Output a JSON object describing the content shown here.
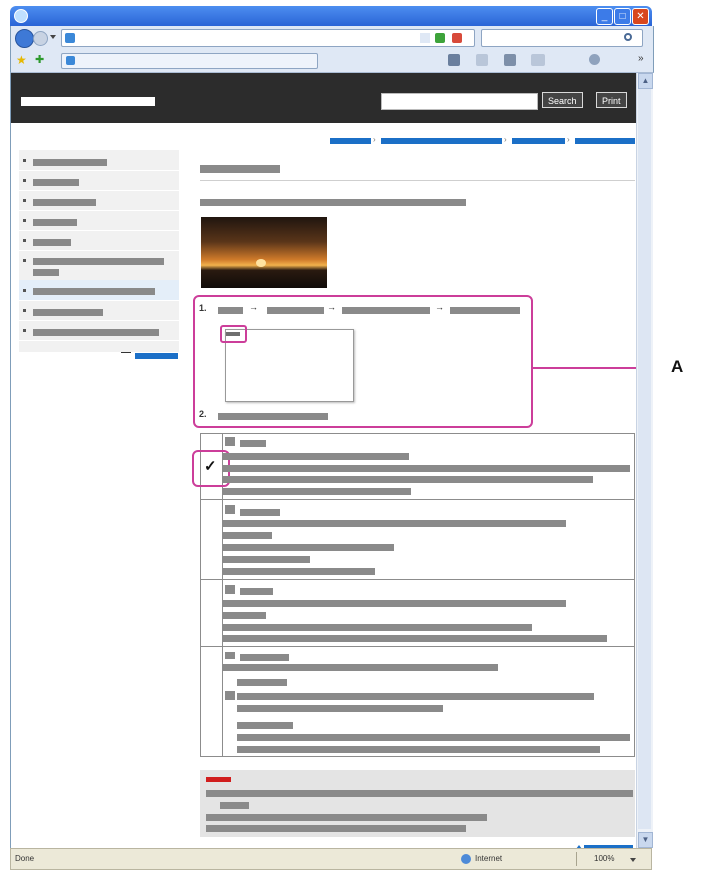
{
  "browser": {
    "window_controls": {
      "minimize": "_",
      "maximize": "□",
      "close": "✕"
    },
    "zoom": "100%",
    "status_left": "Done",
    "status_zone": "Internet"
  },
  "page": {
    "search_button": "Search",
    "print_button": "Print"
  },
  "callout_label": "A",
  "steps": {
    "step1_number": "1.",
    "step2_number": "2."
  },
  "checkmark": "✓",
  "colors": {
    "link_blue": "#1b6fc7",
    "callout_pink": "#cc3e9a",
    "header_dark": "#2c2c2c",
    "note_red": "#d11e1e"
  }
}
